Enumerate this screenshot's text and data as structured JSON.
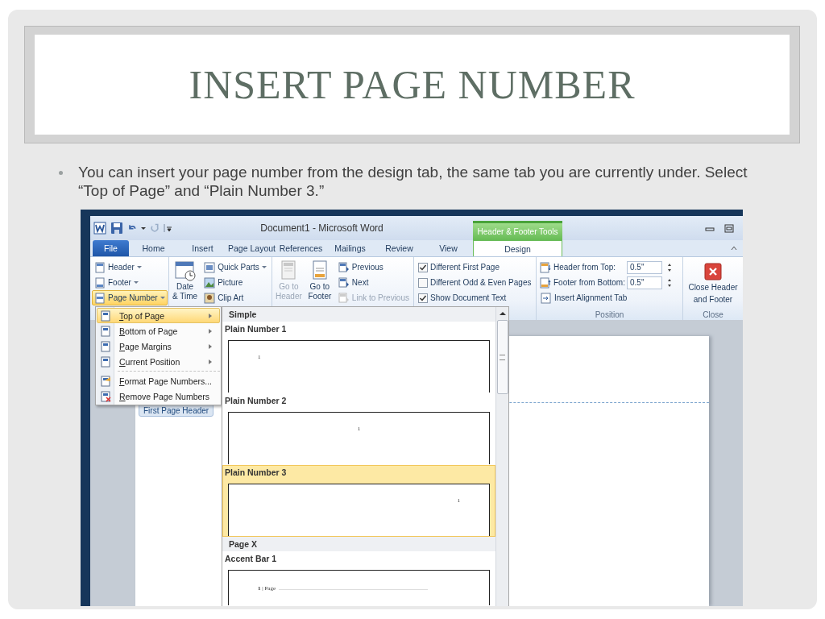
{
  "slide": {
    "title": "INSERT PAGE NUMBER",
    "bullet": "You can insert your page number from the design tab, the same tab you are currently under. Select “Top of Page” and “Plain Number 3.”"
  },
  "window": {
    "title": "Document1 - Microsoft Word",
    "context_label": "Header & Footer Tools"
  },
  "tabs": [
    {
      "label": "File",
      "kind": "file",
      "selected": false
    },
    {
      "label": "Home",
      "kind": "tab",
      "selected": false
    },
    {
      "label": "Insert",
      "kind": "tab",
      "selected": false
    },
    {
      "label": "Page Layout",
      "kind": "tab",
      "selected": false
    },
    {
      "label": "References",
      "kind": "tab",
      "selected": false
    },
    {
      "label": "Mailings",
      "kind": "tab",
      "selected": false
    },
    {
      "label": "Review",
      "kind": "tab",
      "selected": false
    },
    {
      "label": "View",
      "kind": "tab",
      "selected": false
    },
    {
      "label": "Design",
      "kind": "contextual",
      "selected": true
    }
  ],
  "header_footer": [
    {
      "label": "Header",
      "active": false
    },
    {
      "label": "Footer",
      "active": false
    },
    {
      "label": "Page Number",
      "active": true
    }
  ],
  "insert": {
    "date_time": [
      "Date",
      "& Time"
    ],
    "items": [
      {
        "label": "Quick Parts",
        "dropdown": true
      },
      {
        "label": "Picture",
        "dropdown": false
      },
      {
        "label": "Clip Art",
        "dropdown": false
      }
    ]
  },
  "navigation": {
    "go_to": [
      {
        "lines": [
          "Go to",
          "Header"
        ],
        "disabled": true
      },
      {
        "lines": [
          "Go to",
          "Footer"
        ],
        "disabled": false
      }
    ],
    "items": [
      {
        "label": "Previous",
        "disabled": false
      },
      {
        "label": "Next",
        "disabled": false
      },
      {
        "label": "Link to Previous",
        "disabled": true
      }
    ]
  },
  "options": [
    {
      "label": "Different First Page",
      "checked": true
    },
    {
      "label": "Different Odd & Even Pages",
      "checked": false
    },
    {
      "label": "Show Document Text",
      "checked": true
    }
  ],
  "position": {
    "fields": [
      {
        "label": "Header from Top:",
        "value": "0.5\""
      },
      {
        "label": "Footer from Bottom:",
        "value": "0.5\""
      }
    ],
    "alignment_tab": "Insert Alignment Tab",
    "group_label": "Position"
  },
  "close": {
    "lines": [
      "Close Header",
      "and Footer"
    ],
    "group_label": "Close"
  },
  "page_number_menu": [
    {
      "label": "Top of Page",
      "kind": "submenu",
      "selected": true
    },
    {
      "label": "Bottom of Page",
      "kind": "submenu",
      "selected": false
    },
    {
      "label": "Page Margins",
      "kind": "submenu",
      "selected": false
    },
    {
      "label": "Current Position",
      "kind": "submenu",
      "selected": false
    },
    {
      "label": "Format Page Numbers...",
      "kind": "command",
      "selected": false
    },
    {
      "label": "Remove Page Numbers",
      "kind": "command",
      "selected": false
    }
  ],
  "gallery": [
    {
      "heading": "Simple",
      "items": [
        {
          "name": "Plain Number 1",
          "kind": "left",
          "preview": "1",
          "selected": false
        },
        {
          "name": "Plain Number 2",
          "kind": "center",
          "preview": "1",
          "selected": false
        },
        {
          "name": "Plain Number 3",
          "kind": "right",
          "preview": "1",
          "selected": true
        }
      ]
    },
    {
      "heading": "Page X",
      "items": [
        {
          "name": "Accent Bar 1",
          "kind": "accent",
          "preview": "**1** | Page",
          "selected": false
        }
      ]
    }
  ],
  "document": {
    "header_tag": "First Page Header"
  }
}
